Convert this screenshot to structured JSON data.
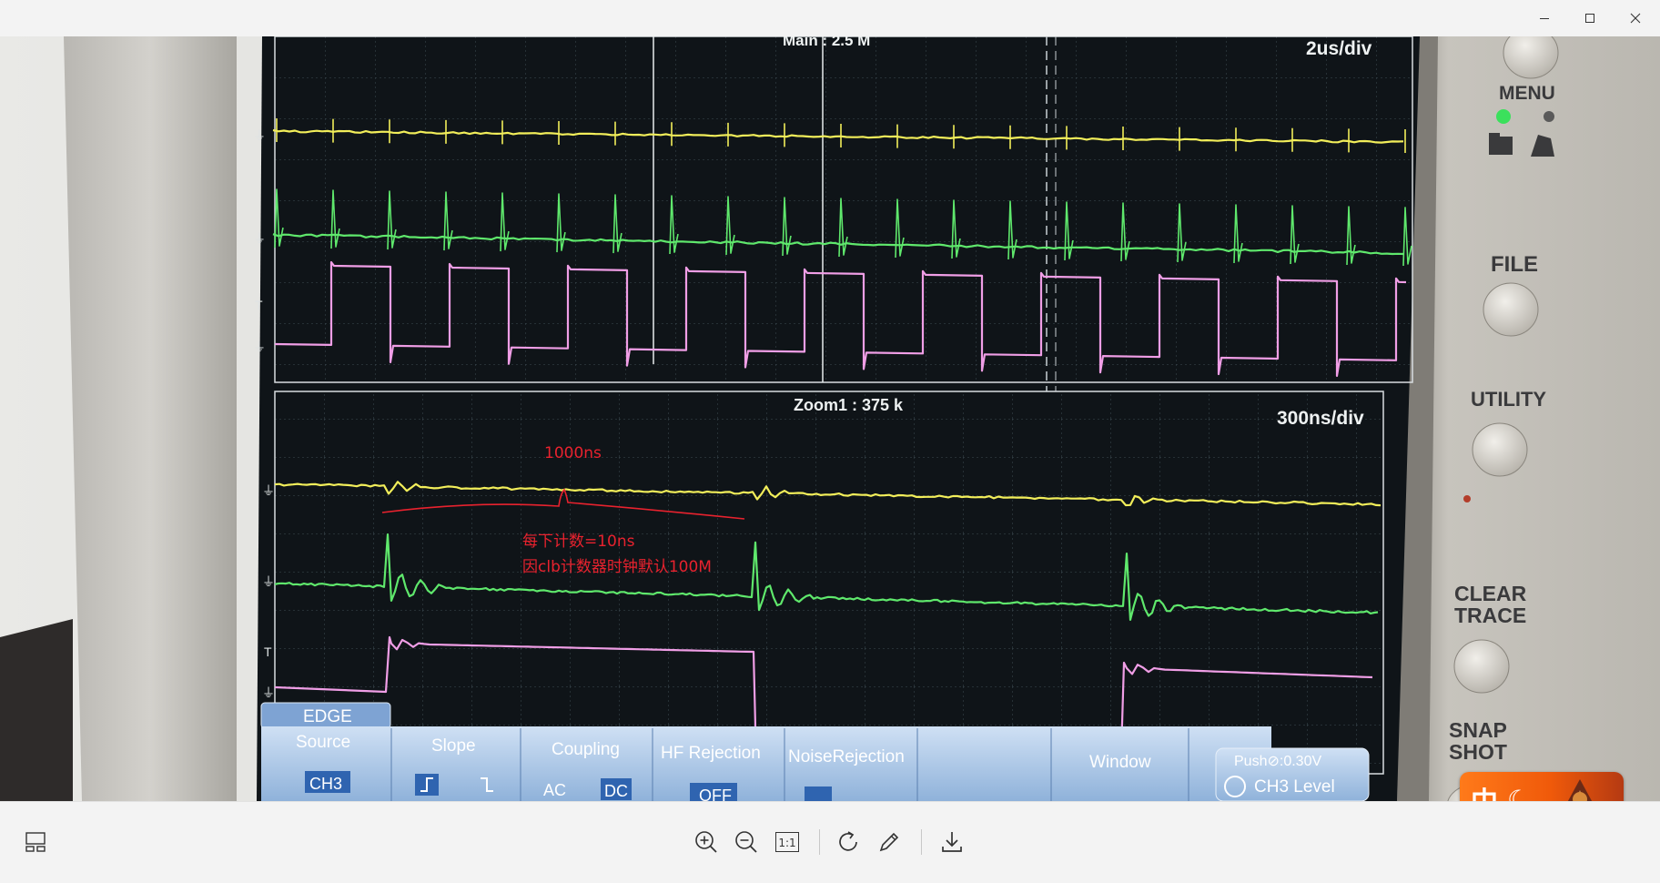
{
  "window": {
    "minimize_icon": "minimize-icon",
    "maximize_icon": "maximize-icon",
    "close_icon": "close-icon"
  },
  "scope": {
    "main_label": "Main : 2.5 M",
    "main_timebase": "2us/div",
    "zoom_label": "Zoom1 : 375 k",
    "zoom_timebase": "300ns/div",
    "side_buttons": [
      "MENU",
      "FILE",
      "UTILITY",
      "CLEAR",
      "TRACE",
      "SNAP",
      "SHOT"
    ],
    "trigger_menu": {
      "title": "EDGE",
      "source_label": "Source",
      "source_value": "CH3",
      "slope_label": "Slope",
      "coupling_label": "Coupling",
      "coupling_ac": "AC",
      "coupling_dc": "DC",
      "hf_label": "HF Rejection",
      "hf_value": "OFF",
      "noise_label": "NoiseRejection",
      "window_label": "Window",
      "level_push": "Push⊘:0.30V",
      "level_label": "CH3 Level"
    },
    "annotations": {
      "period": "1000ns",
      "line1": "每下计数=10ns",
      "line2": "因clb计数器时钟默认100M"
    },
    "colors": {
      "ch1": "#f2ee5a",
      "ch2": "#5fe86c",
      "ch3": "#f09ee6",
      "annotation": "#e8222e"
    }
  },
  "ime": {
    "char": "中",
    "mode_icon": "moon-icon"
  },
  "toolbar": {
    "items": [
      "layout-icon",
      "zoom-in-icon",
      "zoom-out-icon",
      "actual-size-icon",
      "rotate-icon",
      "edit-icon",
      "download-icon"
    ],
    "actual_size_label": "1:1"
  }
}
